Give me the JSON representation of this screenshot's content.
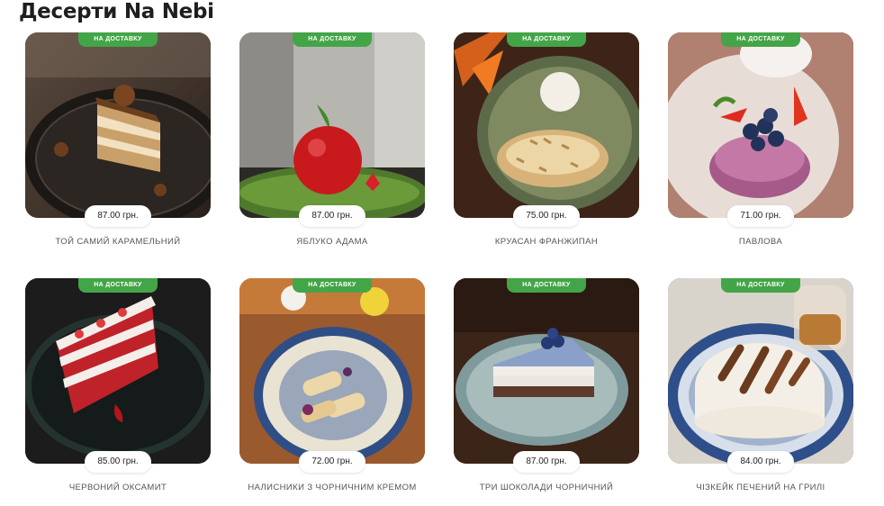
{
  "page": {
    "title": "Десерти Na Nebi"
  },
  "products": [
    {
      "badge": "НА ДОСТАВКУ",
      "price": "87.00 грн.",
      "name": "ТОЙ САМИЙ КАРАМЕЛЬНИЙ"
    },
    {
      "badge": "НА ДОСТАВКУ",
      "price": "87.00 грн.",
      "name": "ЯБЛУКО АДАМА"
    },
    {
      "badge": "НА ДОСТАВКУ",
      "price": "75.00 грн.",
      "name": "КРУАСАН ФРАНЖИПАН"
    },
    {
      "badge": "НА ДОСТАВКУ",
      "price": "71.00 грн.",
      "name": "ПАВЛОВА"
    },
    {
      "badge": "НА ДОСТАВКУ",
      "price": "85.00 грн.",
      "name": "ЧЕРВОНИЙ ОКСАМИТ"
    },
    {
      "badge": "НА ДОСТАВКУ",
      "price": "72.00 грн.",
      "name": "НАЛИСНИКИ З ЧОРНИЧНИМ КРЕМОМ"
    },
    {
      "badge": "НА ДОСТАВКУ",
      "price": "87.00 грн.",
      "name": "ТРИ ШОКОЛАДИ ЧОРНИЧНИЙ"
    },
    {
      "badge": "НА ДОСТАВКУ",
      "price": "84.00 грн.",
      "name": "ЧІЗКЕЙК ПЕЧЕНИЙ НА ГРИЛІ"
    }
  ],
  "colors": {
    "badge": "#43a547",
    "title": "#1e1e1e",
    "name": "#555555"
  }
}
